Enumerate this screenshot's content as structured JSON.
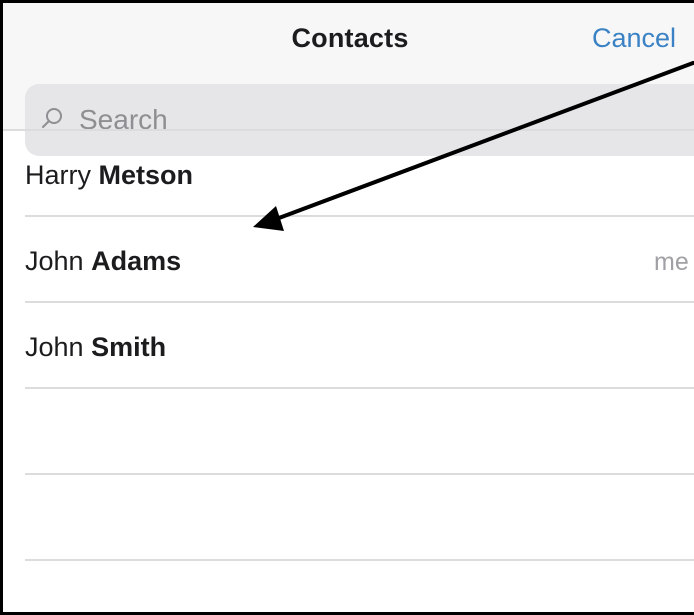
{
  "nav": {
    "title": "Contacts",
    "cancel_label": "Cancel"
  },
  "search": {
    "placeholder": "Search",
    "value": ""
  },
  "contacts": [
    {
      "first": "Harry",
      "last": "Metson",
      "badge": ""
    },
    {
      "first": "John",
      "last": "Adams",
      "badge": "me"
    },
    {
      "first": "John",
      "last": "Smith",
      "badge": ""
    }
  ],
  "icons": {
    "search": "search-icon"
  },
  "colors": {
    "accent": "#3a82c4",
    "separator": "#dcdcdf",
    "search_bg": "#e6e6e9",
    "placeholder": "#8e8e93",
    "annotation": "#000000"
  }
}
